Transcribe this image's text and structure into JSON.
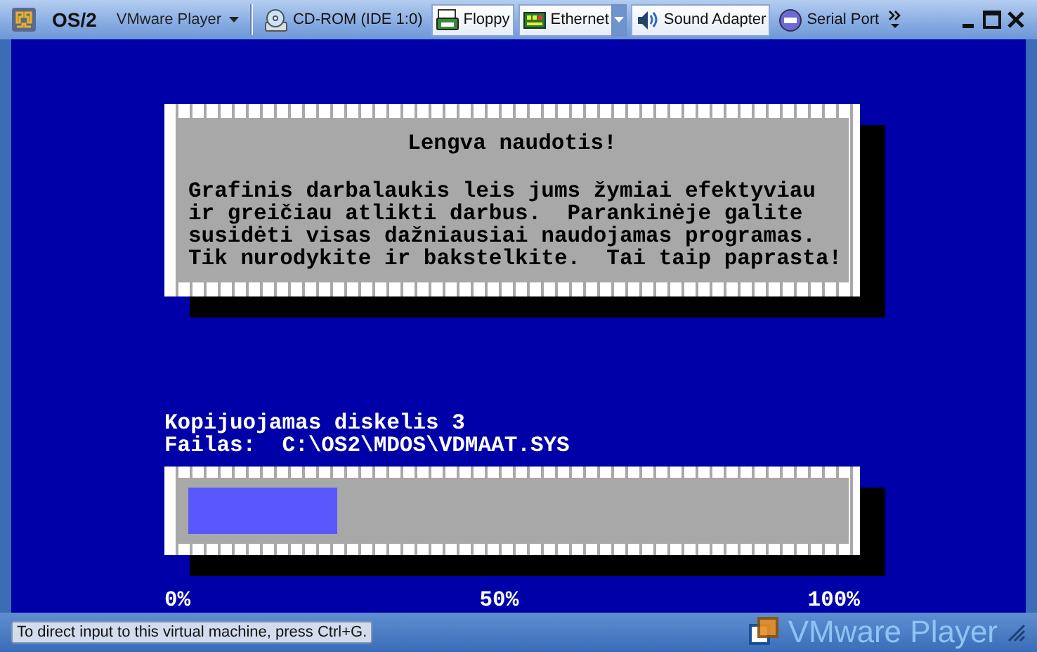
{
  "window": {
    "title": "OS/2"
  },
  "toolbar": {
    "menu": "VMware Player",
    "devices": [
      {
        "label": "CD-ROM (IDE 1:0)",
        "kind": "cdrom",
        "active": false
      },
      {
        "label": "Floppy",
        "kind": "floppy",
        "active": true
      },
      {
        "label": "Ethernet",
        "kind": "network",
        "active": true,
        "dropdown": true
      },
      {
        "label": "Sound Adapter",
        "kind": "sound",
        "active": true
      },
      {
        "label": "Serial Port",
        "kind": "serial",
        "active": false
      }
    ]
  },
  "dialog": {
    "title": "Lengva naudotis!",
    "lines": [
      "Grafinis darbalaukis leis jums žymiai efektyviau",
      "ir greičiau atlikti darbus.  Parankinėje galite",
      "susidėti visas dažniausiai naudojamas programas.",
      "Tik nurodykite ir bakstelkite.  Tai taip paprasta!"
    ]
  },
  "progress": {
    "lines": [
      "Kopijuojamas diskelis 3",
      "Failas:  C:\\OS2\\MDOS\\VDMAAT.SYS"
    ],
    "level": 0.23,
    "ticks": [
      "0%",
      "50%",
      "100%"
    ]
  },
  "status_bar": {
    "hint": "To direct input to this virtual machine, press Ctrl+G.",
    "brand": "VMware Player"
  }
}
